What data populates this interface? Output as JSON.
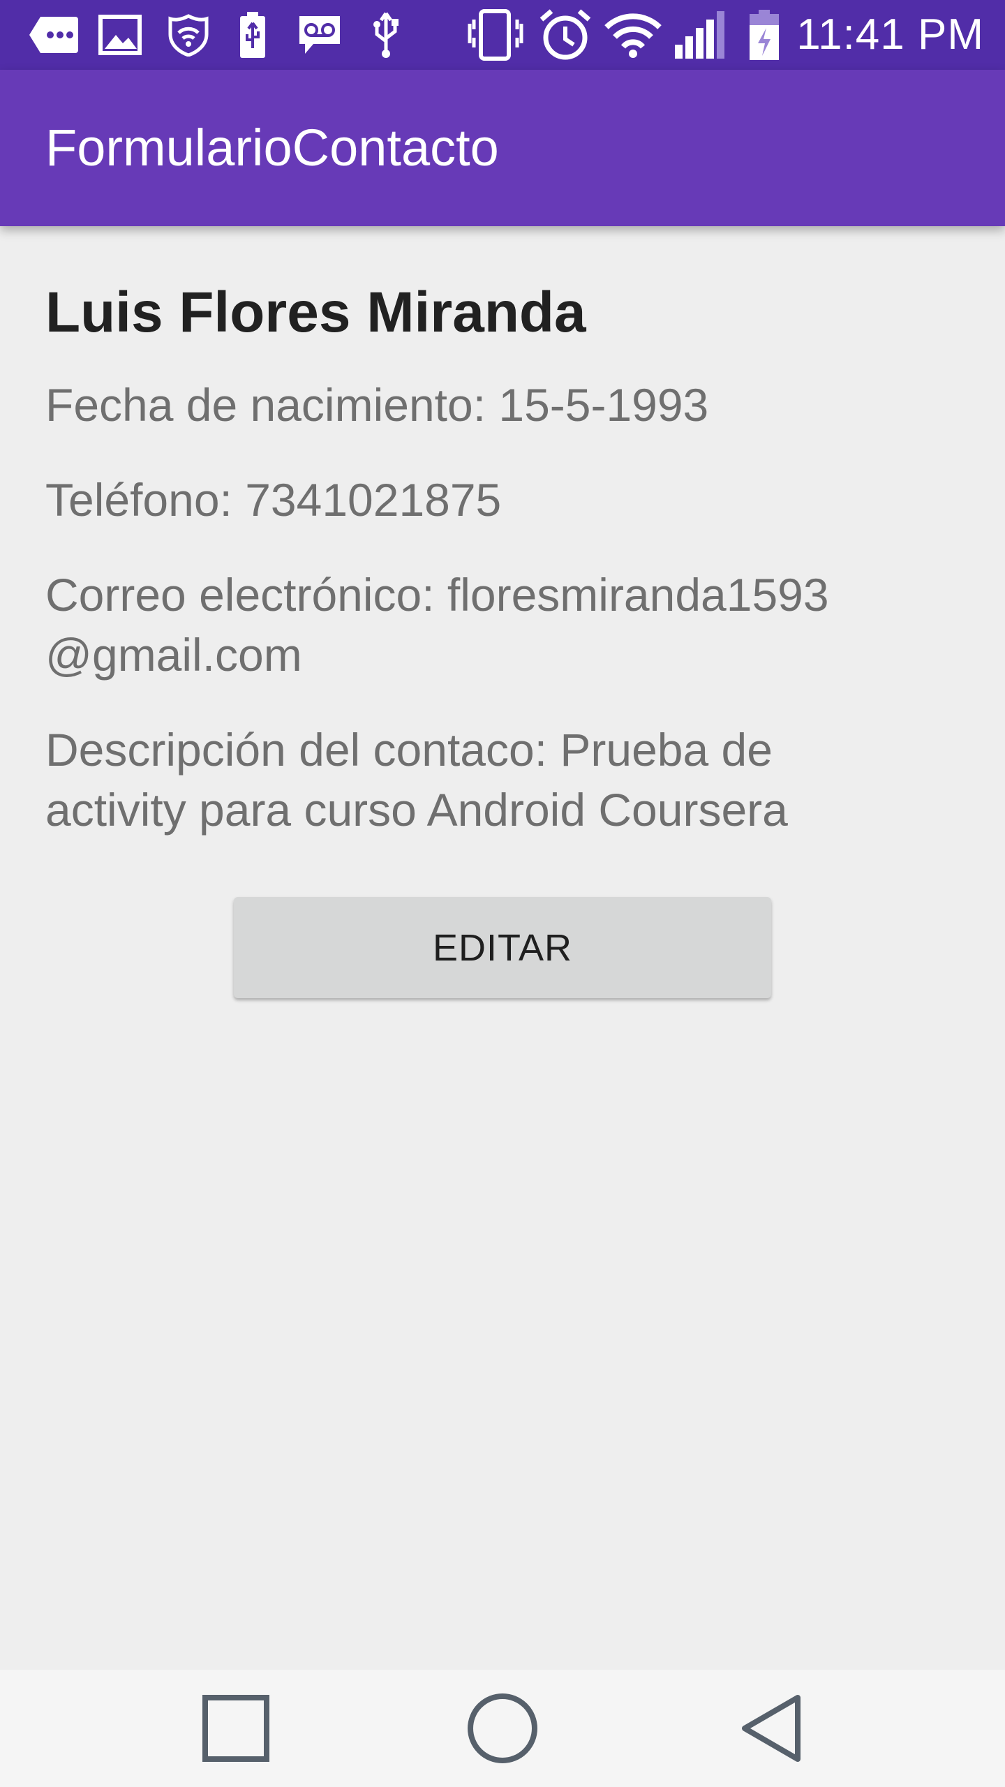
{
  "status_bar": {
    "time": "11:41 PM",
    "left_icons": [
      "more-notifications-icon",
      "image-icon",
      "vpn-shield-icon",
      "usb-battery-icon",
      "voicemail-icon",
      "usb-icon"
    ],
    "right_icons": [
      "vibrate-icon",
      "alarm-icon",
      "wifi-icon",
      "signal-icon",
      "battery-charging-icon"
    ]
  },
  "app_bar": {
    "title": "FormularioContacto"
  },
  "contact": {
    "name": "Luis Flores Miranda",
    "birth_date": "Fecha de nacimiento: 15-5-1993",
    "phone": "Teléfono: 7341021875",
    "email_line1": "Correo electrónico: floresmiranda1593",
    "email_line2": "@gmail.com",
    "description_line1": "Descripción del contaco: Prueba de",
    "description_line2": "activity para curso Android Coursera"
  },
  "actions": {
    "edit_label": "EDITAR"
  },
  "nav_bar": {
    "buttons": [
      "recents-square-icon",
      "home-circle-icon",
      "back-triangle-icon"
    ]
  },
  "colors": {
    "status_bar": "#512da8",
    "app_bar": "#673ab7",
    "background": "#eeeeee",
    "button": "#d6d7d7"
  }
}
